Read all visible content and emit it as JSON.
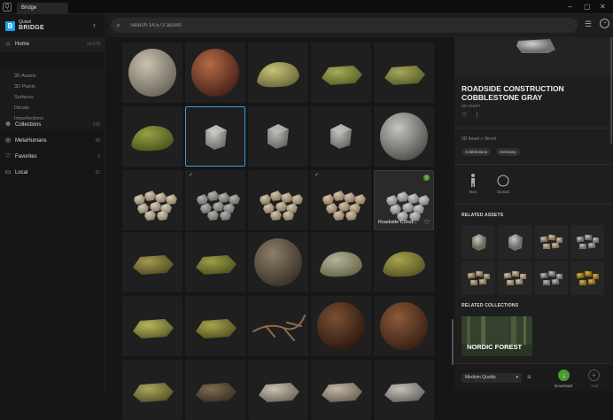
{
  "window": {
    "tab_title": "Bridge",
    "controls": [
      "–",
      "▢",
      "✕"
    ]
  },
  "brand": {
    "line1": "Quixel",
    "line2": "BRIDGE"
  },
  "sidebar": {
    "items": [
      {
        "label": "Home",
        "count": "14,573",
        "icon": "home-icon"
      },
      {
        "label": "Collections",
        "count": "130",
        "icon": "collections-icon"
      },
      {
        "label": "MetaHumans",
        "count": "98",
        "icon": "metahumans-icon"
      },
      {
        "label": "Favorites",
        "count": "0",
        "icon": "heart-icon"
      },
      {
        "label": "Local",
        "count": "92",
        "icon": "monitor-icon"
      }
    ],
    "subitems": [
      "3D Assets",
      "3D Plants",
      "Surfaces",
      "Decals",
      "Imperfections"
    ]
  },
  "search": {
    "placeholder": "Search 14,573 assets",
    "value": ""
  },
  "grid": {
    "hovered_asset_name": "Roadside Const...",
    "items": [
      {
        "kind": "sphere",
        "c1": "#c9c2b0",
        "c2": "#6d685c"
      },
      {
        "kind": "sphere",
        "c1": "#b46a47",
        "c2": "#4a2418"
      },
      {
        "kind": "rock",
        "c1": "#c7c37a",
        "c2": "#6f6b3a"
      },
      {
        "kind": "flat",
        "c1": "#a8ad58",
        "c2": "#5d612a"
      },
      {
        "kind": "flat",
        "c1": "#a6a85a",
        "c2": "#5c5f2b"
      },
      {
        "kind": "rock",
        "c1": "#95a143",
        "c2": "#4f5720"
      },
      {
        "kind": "cube",
        "c1": "#c9c9c6",
        "c2": "#6e6e6c",
        "selected": true
      },
      {
        "kind": "cube",
        "c1": "#bdbdba",
        "c2": "#666664"
      },
      {
        "kind": "cube",
        "c1": "#c2c2bf",
        "c2": "#686866"
      },
      {
        "kind": "sphere",
        "c1": "#c7c5c0",
        "c2": "#55534f"
      },
      {
        "kind": "pile",
        "c1": "#d8ccb6",
        "c2": "#8a7c66"
      },
      {
        "kind": "pile",
        "c1": "#b4b4b0",
        "c2": "#6a6a67",
        "check": true
      },
      {
        "kind": "pile",
        "c1": "#d2c5ad",
        "c2": "#86775f"
      },
      {
        "kind": "pile",
        "c1": "#d4c3a8",
        "c2": "#8a7760",
        "check": true
      },
      {
        "kind": "pile",
        "c1": "#cfcfcc",
        "c2": "#7a7a78",
        "hover": true,
        "download": true
      },
      {
        "kind": "flat",
        "c1": "#a39a4f",
        "c2": "#564f24"
      },
      {
        "kind": "flat",
        "c1": "#9aa047",
        "c2": "#50541f"
      },
      {
        "kind": "sphere",
        "c1": "#8c7d68",
        "c2": "#3c342a"
      },
      {
        "kind": "rock",
        "c1": "#b6b39a",
        "c2": "#6b6a4c"
      },
      {
        "kind": "rock",
        "c1": "#a8a44e",
        "c2": "#5b5825"
      },
      {
        "kind": "flat",
        "c1": "#b6b65c",
        "c2": "#60602c"
      },
      {
        "kind": "flat",
        "c1": "#a7a44c",
        "c2": "#575422"
      },
      {
        "kind": "twig",
        "c1": "#8d6a4a",
        "c2": "#4a3422"
      },
      {
        "kind": "sphere",
        "c1": "#7b4f33",
        "c2": "#2e1a10"
      },
      {
        "kind": "sphere",
        "c1": "#8a5a3a",
        "c2": "#3a2214"
      },
      {
        "kind": "flat",
        "c1": "#a9a65a",
        "c2": "#57542a"
      },
      {
        "kind": "flat",
        "c1": "#7d6a50",
        "c2": "#3d3226"
      },
      {
        "kind": "flat",
        "c1": "#c9c2b2",
        "c2": "#6e685c"
      },
      {
        "kind": "flat",
        "c1": "#c3b8a6",
        "c2": "#6a6254"
      },
      {
        "kind": "flat",
        "c1": "#c4c1b8",
        "c2": "#6a6864"
      }
    ]
  },
  "panel": {
    "title": "ROADSIDE CONSTRUCTION COBBLESTONE GRAY",
    "type": "3D ASSET",
    "breadcrumb": "3D Asset  >  Street",
    "tags": [
      "Cobblestone",
      "Germany"
    ],
    "sizes": [
      "Bus",
      "Closed"
    ],
    "related_assets_title": "RELATED ASSETS",
    "related_collections_title": "RELATED COLLECTIONS",
    "collection_name": "NORDIC FOREST",
    "quality": "Medium Quality",
    "download_label": "Download",
    "add_label": "Add",
    "related": [
      {
        "c1": "#cbc6b8",
        "c2": "#6d695e"
      },
      {
        "c1": "#c9c9c6",
        "c2": "#6e6e6c"
      },
      {
        "c1": "#d6c6a8",
        "c2": "#8a7760"
      },
      {
        "c1": "#c6c6c2",
        "c2": "#707070"
      },
      {
        "c1": "#d2c3a7",
        "c2": "#86755d"
      },
      {
        "c1": "#d8cbb4",
        "c2": "#8a7c66"
      },
      {
        "c1": "#c4c4c0",
        "c2": "#6e6e6c"
      },
      {
        "c1": "#e0b945",
        "c2": "#8a6a18"
      }
    ]
  }
}
